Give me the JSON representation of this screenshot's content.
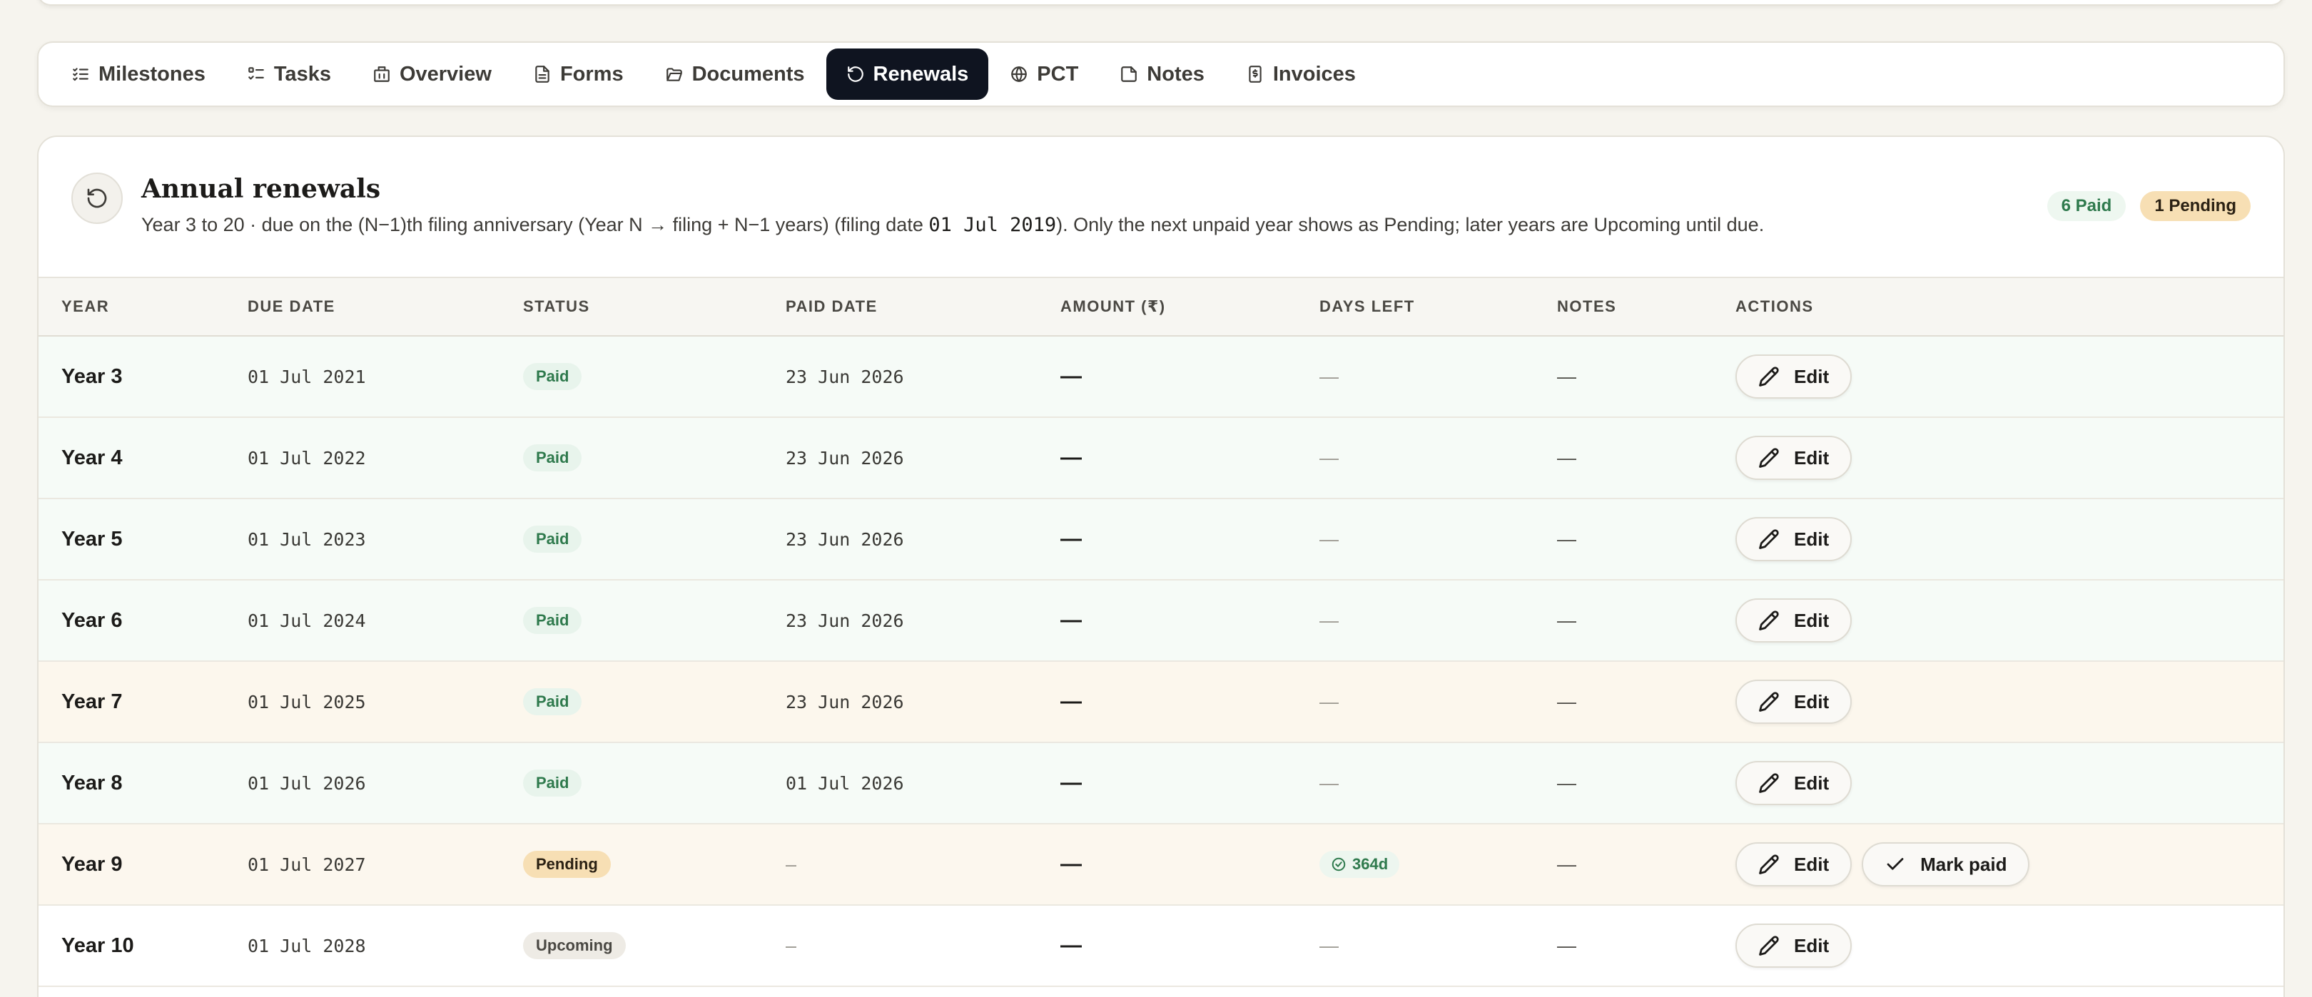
{
  "tabs": [
    {
      "label": "Milestones",
      "icon": "list-check-icon",
      "active": false
    },
    {
      "label": "Tasks",
      "icon": "checklist-icon",
      "active": false
    },
    {
      "label": "Overview",
      "icon": "building-icon",
      "active": false
    },
    {
      "label": "Forms",
      "icon": "file-text-icon",
      "active": false
    },
    {
      "label": "Documents",
      "icon": "folder-open-icon",
      "active": false
    },
    {
      "label": "Renewals",
      "icon": "rotate-ccw-icon",
      "active": true
    },
    {
      "label": "PCT",
      "icon": "globe-icon",
      "active": false
    },
    {
      "label": "Notes",
      "icon": "sticky-note-icon",
      "active": false
    },
    {
      "label": "Invoices",
      "icon": "receipt-icon",
      "active": false
    }
  ],
  "section": {
    "title": "Annual renewals",
    "subtitle_pre": "Year 3 to 20 · due on the (N−1)th filing anniversary (Year N → filing + N−1 years) (filing date ",
    "filing_date": "01 Jul 2019",
    "subtitle_post": "). Only the next unpaid year shows as Pending; later years are Upcoming until due.",
    "badges": {
      "paid": "6 Paid",
      "pending": "1 Pending"
    }
  },
  "table": {
    "columns": {
      "year": "YEAR",
      "due_date": "DUE DATE",
      "status": "STATUS",
      "paid_date": "PAID DATE",
      "amount": "AMOUNT (₹)",
      "days_left": "DAYS LEFT",
      "notes": "NOTES",
      "actions": "ACTIONS"
    },
    "edit_label": "Edit",
    "mark_paid_label": "Mark paid",
    "rows": [
      {
        "year": "Year 3",
        "due": "01 Jul 2021",
        "status": "Paid",
        "paid": "23 Jun 2026",
        "amount": "—",
        "days": "—",
        "notes": "—"
      },
      {
        "year": "Year 4",
        "due": "01 Jul 2022",
        "status": "Paid",
        "paid": "23 Jun 2026",
        "amount": "—",
        "days": "—",
        "notes": "—"
      },
      {
        "year": "Year 5",
        "due": "01 Jul 2023",
        "status": "Paid",
        "paid": "23 Jun 2026",
        "amount": "—",
        "days": "—",
        "notes": "—"
      },
      {
        "year": "Year 6",
        "due": "01 Jul 2024",
        "status": "Paid",
        "paid": "23 Jun 2026",
        "amount": "—",
        "days": "—",
        "notes": "—"
      },
      {
        "year": "Year 7",
        "due": "01 Jul 2025",
        "status": "Paid",
        "paid": "23 Jun 2026",
        "amount": "—",
        "days": "—",
        "notes": "—"
      },
      {
        "year": "Year 8",
        "due": "01 Jul 2026",
        "status": "Paid",
        "paid": "01 Jul 2026",
        "amount": "—",
        "days": "—",
        "notes": "—"
      },
      {
        "year": "Year 9",
        "due": "01 Jul 2027",
        "status": "Pending",
        "paid": "–",
        "amount": "—",
        "days": "364d",
        "notes": "—"
      },
      {
        "year": "Year 10",
        "due": "01 Jul 2028",
        "status": "Upcoming",
        "paid": "–",
        "amount": "—",
        "days": "—",
        "notes": "—"
      }
    ]
  },
  "colors": {
    "active_tab_bg": "#0f1420",
    "paid_green": "#2f7a4d",
    "pending_amber": "#f7dfb4",
    "page_bg": "#f6f4ee"
  }
}
